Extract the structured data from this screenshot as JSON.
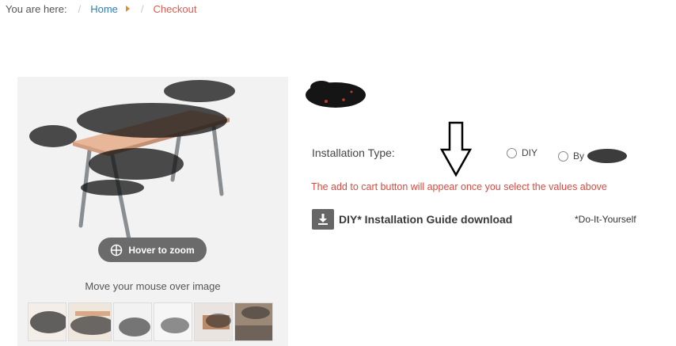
{
  "breadcrumb": {
    "lead": "You are here:",
    "home": "Home",
    "current": "Checkout"
  },
  "gallery": {
    "zoom_label": "Hover to zoom",
    "hint": "Move your mouse over image",
    "thumbnail_count": 6
  },
  "product": {
    "installation_label": "Installation Type:",
    "options": [
      {
        "label": "DIY",
        "selected": false
      },
      {
        "label": "By",
        "selected": false
      }
    ],
    "cart_notice": "The add to cart button will appear once you select the values above",
    "download_label": "DIY* Installation Guide download",
    "diy_note": "*Do-It-Yourself"
  },
  "colors": {
    "link": "#2f7fb5",
    "current": "#e05a4e",
    "notice": "#d84a3f",
    "button": "#666666"
  }
}
